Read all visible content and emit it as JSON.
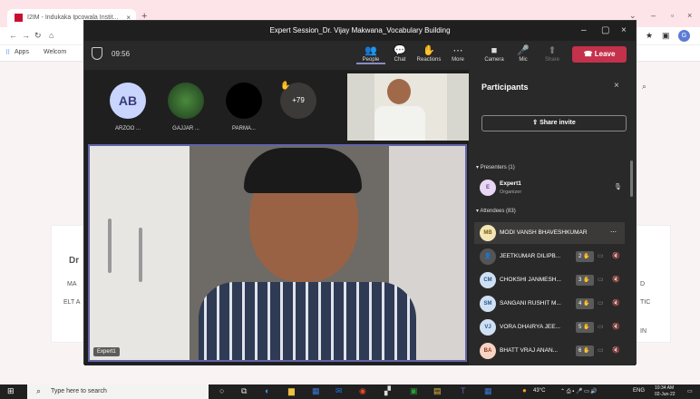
{
  "browser": {
    "tab_title": "I2IM - Indukaka Ipcowala Instit...",
    "bookmarks": [
      "Apps",
      "Welcom"
    ]
  },
  "teams": {
    "window_title": "Expert Session_Dr. Vijay Makwana_Vocabulary Building",
    "timer": "09:56",
    "toolbar": {
      "people": "People",
      "chat": "Chat",
      "reactions": "Reactions",
      "more": "More",
      "camera": "Camera",
      "mic": "Mic",
      "share": "Share",
      "leave": "Leave"
    },
    "tiles": [
      {
        "initials": "AB",
        "label": "ARZOO ...",
        "color": "#c9d5ff"
      },
      {
        "initials": "",
        "label": "GAJJAR ...",
        "color": "#2a4a2c"
      },
      {
        "initials": "",
        "label": "PARMA...",
        "color": "#000000"
      },
      {
        "initials": "+79",
        "label": "",
        "color": "#3b3a39"
      }
    ],
    "main_video_label": "Expert1",
    "panel": {
      "title": "Participants",
      "share_invite": "Share invite",
      "presenters_header": "Presenters (1)",
      "presenter": {
        "initials": "E",
        "name": "Expert1",
        "role": "Organizer"
      },
      "attendees_header": "Attendees (83)",
      "attendees": [
        {
          "initials": "MB",
          "name": "MODI VANSH BHAVESHKUMAR",
          "hand": ""
        },
        {
          "initials": "",
          "name": "JEETKUMAR DILIPB...",
          "hand": "2"
        },
        {
          "initials": "CM",
          "name": "CHOKSHI JANMESH...",
          "hand": "3"
        },
        {
          "initials": "SM",
          "name": "SANGANI RUSHIT M...",
          "hand": "4"
        },
        {
          "initials": "VJ",
          "name": "VORA DHAIRYA JEE...",
          "hand": "5"
        },
        {
          "initials": "BA",
          "name": "BHATT VRAJ ANAN...",
          "hand": "6"
        }
      ]
    }
  },
  "background_page": {
    "fragments": [
      "Dr",
      "MA",
      "ELT A",
      "D",
      "TIC",
      "IN"
    ]
  },
  "taskbar": {
    "search_placeholder": "Type here to search",
    "weather": "43°C",
    "lang": "ENG",
    "time": "10:34 AM",
    "date": "02-Jun-22"
  }
}
